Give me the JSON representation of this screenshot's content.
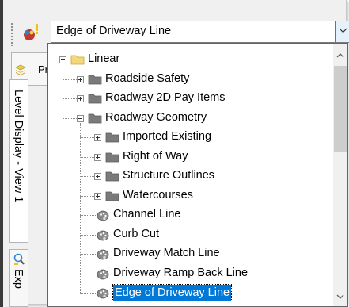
{
  "combo": {
    "selected_value": "Edge of Driveway Line"
  },
  "tabs": {
    "top_tab_label": "Pr",
    "level_display": "Level Display - View 1",
    "explorer": "Exp"
  },
  "tree": {
    "items": [
      {
        "label": "Linear",
        "type": "folder-open",
        "depth": 0,
        "expander": "minus"
      },
      {
        "label": "Roadside Safety",
        "type": "folder",
        "depth": 1,
        "expander": "plus"
      },
      {
        "label": "Roadway 2D Pay Items",
        "type": "folder",
        "depth": 1,
        "expander": "plus"
      },
      {
        "label": "Roadway Geometry",
        "type": "folder",
        "depth": 1,
        "expander": "minus"
      },
      {
        "label": "Imported Existing",
        "type": "folder",
        "depth": 2,
        "expander": "plus"
      },
      {
        "label": "Right of Way",
        "type": "folder",
        "depth": 2,
        "expander": "plus"
      },
      {
        "label": "Structure Outlines",
        "type": "folder",
        "depth": 2,
        "expander": "plus"
      },
      {
        "label": "Watercourses",
        "type": "folder",
        "depth": 2,
        "expander": "plus"
      },
      {
        "label": "Channel Line",
        "type": "level",
        "depth": 2
      },
      {
        "label": "Curb Cut",
        "type": "level",
        "depth": 2
      },
      {
        "label": "Driveway Match Line",
        "type": "level",
        "depth": 2
      },
      {
        "label": "Driveway Ramp Back Line",
        "type": "level",
        "depth": 2
      },
      {
        "label": "Edge of Driveway Line",
        "type": "level",
        "depth": 2,
        "selected": true
      }
    ]
  },
  "colors": {
    "selection": "#0078d7",
    "folder": "#f3d77a",
    "folder_dark": "#7a7a7a"
  }
}
